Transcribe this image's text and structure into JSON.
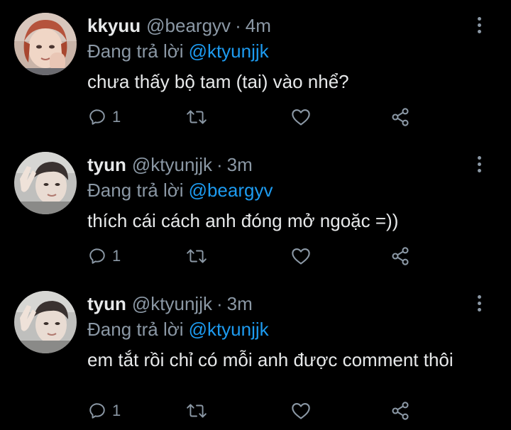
{
  "colors": {
    "background": "#000000",
    "primary_text": "#e7e9ea",
    "secondary_text": "#8b98a5",
    "accent": "#1d9bf0"
  },
  "tweets": [
    {
      "display_name": "kkyuu",
      "handle": "@beargyv",
      "separator": "·",
      "time": "4m",
      "reply_prefix": "Đang trả lời",
      "reply_to": "@ktyunjjk",
      "text": "chưa thấy bộ tam (tai) vào nhể?",
      "reply_count": "1",
      "avatar_icon": "user-avatar-photo"
    },
    {
      "display_name": "tyun",
      "handle": "@ktyunjjk",
      "separator": "·",
      "time": "3m",
      "reply_prefix": "Đang trả lời",
      "reply_to": "@beargyv",
      "text": "thích cái cách anh đóng mở ngoặc =))",
      "reply_count": "1",
      "avatar_icon": "user-avatar-photo"
    },
    {
      "display_name": "tyun",
      "handle": "@ktyunjjk",
      "separator": "·",
      "time": "3m",
      "reply_prefix": "Đang trả lời",
      "reply_to": "@ktyunjjk",
      "text": "em tắt rồi chỉ có mỗi anh được comment thôi",
      "reply_count": "1",
      "avatar_icon": "user-avatar-photo"
    }
  ],
  "action_icons": [
    "reply-icon",
    "retweet-icon",
    "like-icon",
    "share-icon"
  ]
}
